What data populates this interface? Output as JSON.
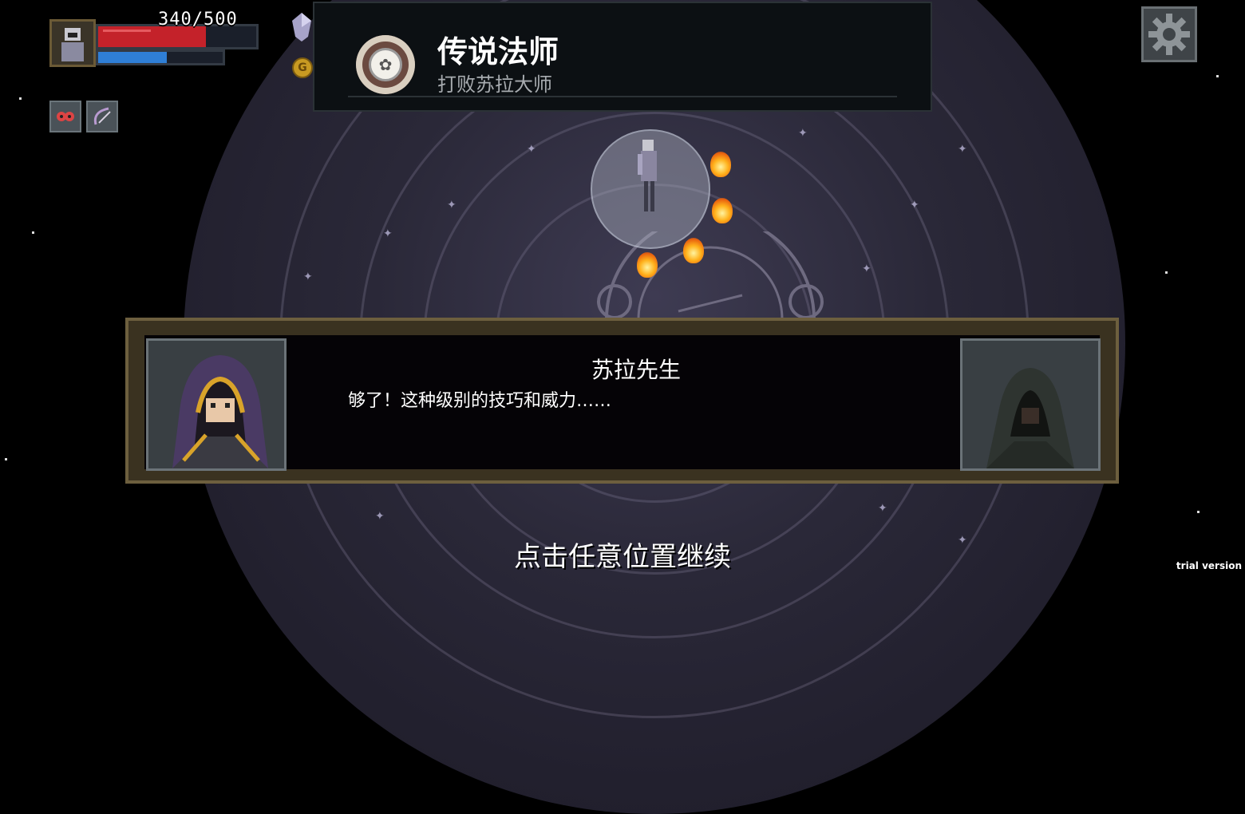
{
  "hud": {
    "hp": {
      "text": "340/500",
      "fraction": 0.68
    },
    "mp": {
      "fraction": 0.55
    },
    "coin_symbol": "G"
  },
  "achievement": {
    "title": "传说法师",
    "subtitle": "打败苏拉大师"
  },
  "dialog": {
    "speaker": "苏拉先生",
    "line": "够了！这种级别的技巧和威力……"
  },
  "prompt": "点击任意位置继续",
  "watermark": "trial version",
  "icons": {
    "portrait": "player-portrait-icon",
    "crystal": "crystal-icon",
    "coin": "gold-coin-icon",
    "skill_1": "mask-skill-icon",
    "skill_2": "bow-skill-icon",
    "settings": "gear-icon",
    "badge": "achievement-medal-icon"
  },
  "colors": {
    "hp": "#c4222a",
    "mp": "#2f7fd6",
    "dialog_frame": "#6d5f3e",
    "fire": "#ffb21c"
  }
}
